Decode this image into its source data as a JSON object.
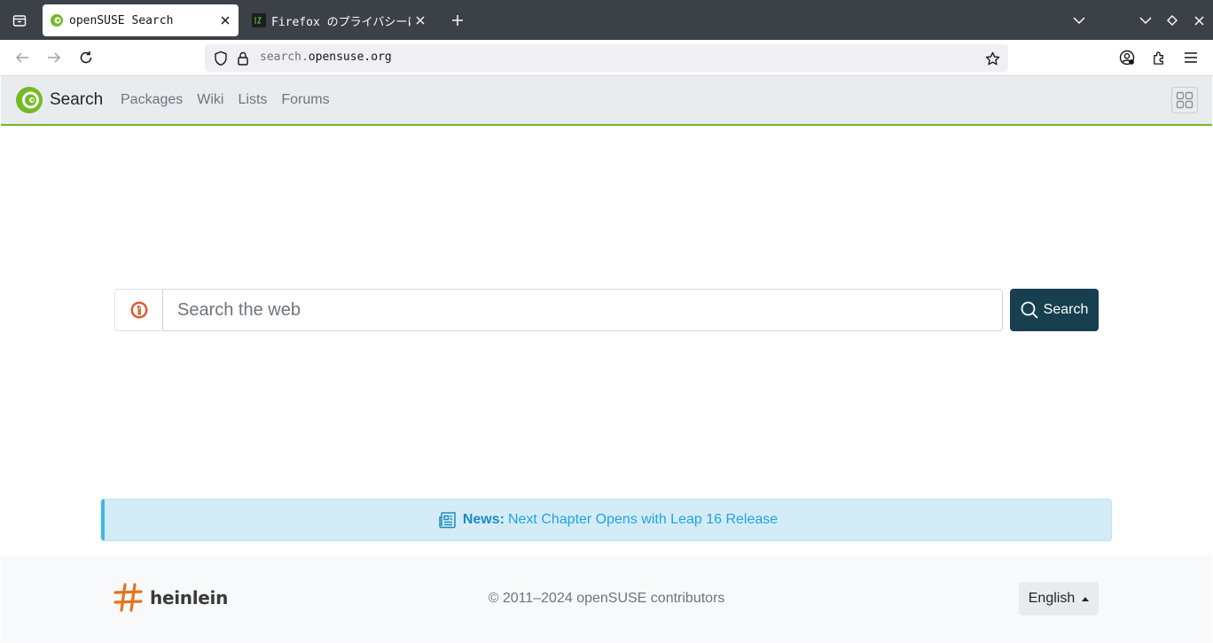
{
  "browser": {
    "tabs": [
      {
        "title": "openSUSE Search",
        "active": true
      },
      {
        "title": "Firefox のプライバシーに関",
        "active": false
      }
    ],
    "url_dim": "search.",
    "url_main": "opensuse.org"
  },
  "header": {
    "brand": "Search",
    "nav": [
      "Packages",
      "Wiki",
      "Lists",
      "Forums"
    ]
  },
  "search": {
    "placeholder": "Search the web",
    "button_label": "Search"
  },
  "news": {
    "label": "News:",
    "headline": "Next Chapter Opens with Leap 16 Release"
  },
  "footer": {
    "sponsor": "heinlein",
    "copyright": "© 2011–2024 openSUSE contributors",
    "language": "English"
  },
  "colors": {
    "brand_green": "#73ba25",
    "search_button": "#173f4f",
    "news_accent": "#35b9ea",
    "sponsor_orange": "#e8731c"
  }
}
